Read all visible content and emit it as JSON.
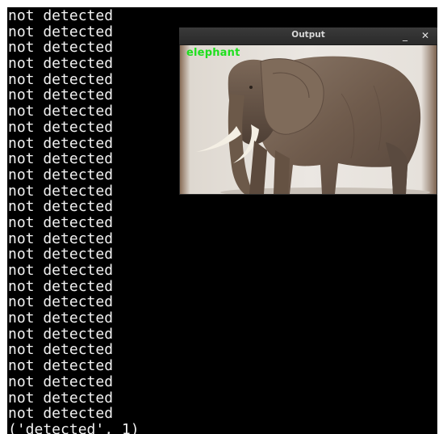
{
  "terminal": {
    "lines": [
      "not detected",
      "not detected",
      "not detected",
      "not detected",
      "not detected",
      "not detected",
      "not detected",
      "not detected",
      "not detected",
      "not detected",
      "not detected",
      "not detected",
      "not detected",
      "not detected",
      "not detected",
      "not detected",
      "not detected",
      "not detected",
      "not detected",
      "not detected",
      "not detected",
      "not detected",
      "not detected",
      "not detected",
      "not detected",
      "not detected",
      "('detected', 1)"
    ]
  },
  "window": {
    "title": "Output",
    "minimize_glyph": "_",
    "close_glyph": "✕",
    "detection_label": "elephant"
  },
  "colors": {
    "terminal_bg": "#000000",
    "terminal_text": "#f2f2f2",
    "label": "#1ee01e",
    "titlebar": "#2f2f2f"
  }
}
